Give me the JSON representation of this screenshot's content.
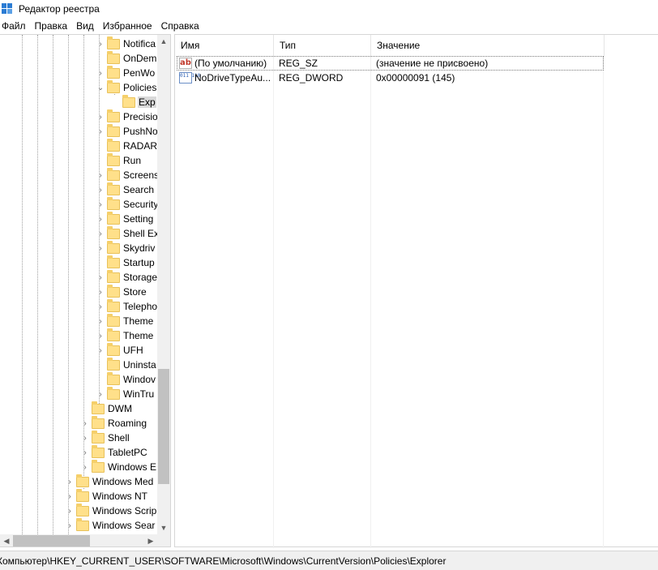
{
  "window": {
    "title": "Редактор реестра"
  },
  "menu": [
    "Файл",
    "Правка",
    "Вид",
    "Избранное",
    "Справка"
  ],
  "tree": {
    "items": [
      {
        "label": "Notifica",
        "expander": "›",
        "level": 3
      },
      {
        "label": "OnDem",
        "expander": "",
        "level": 3
      },
      {
        "label": "PenWo",
        "expander": "›",
        "level": 3
      },
      {
        "label": "Policies",
        "expander": "⌄",
        "level": 3
      },
      {
        "label": "Exp",
        "expander": "",
        "level": 4,
        "selected": true
      },
      {
        "label": "Precisio",
        "expander": "›",
        "level": 3
      },
      {
        "label": "PushNo",
        "expander": "›",
        "level": 3
      },
      {
        "label": "RADAR",
        "expander": "",
        "level": 3
      },
      {
        "label": "Run",
        "expander": "",
        "level": 3
      },
      {
        "label": "Screens",
        "expander": "›",
        "level": 3
      },
      {
        "label": "Search",
        "expander": "›",
        "level": 3
      },
      {
        "label": "Security",
        "expander": "›",
        "level": 3
      },
      {
        "label": "Setting",
        "expander": "›",
        "level": 3
      },
      {
        "label": "Shell Ex",
        "expander": "›",
        "level": 3
      },
      {
        "label": "Skydriv",
        "expander": "›",
        "level": 3
      },
      {
        "label": "Startup",
        "expander": "",
        "level": 3
      },
      {
        "label": "Storage",
        "expander": "›",
        "level": 3
      },
      {
        "label": "Store",
        "expander": "›",
        "level": 3
      },
      {
        "label": "Telepho",
        "expander": "›",
        "level": 3
      },
      {
        "label": "Theme",
        "expander": "›",
        "level": 3
      },
      {
        "label": "Theme",
        "expander": "›",
        "level": 3
      },
      {
        "label": "UFH",
        "expander": "›",
        "level": 3
      },
      {
        "label": "Uninsta",
        "expander": "",
        "level": 3
      },
      {
        "label": "Windov",
        "expander": "",
        "level": 3
      },
      {
        "label": "WinTru",
        "expander": "›",
        "level": 3
      },
      {
        "label": "DWM",
        "expander": "",
        "level": 2
      },
      {
        "label": "Roaming",
        "expander": "›",
        "level": 2
      },
      {
        "label": "Shell",
        "expander": "›",
        "level": 2
      },
      {
        "label": "TabletPC",
        "expander": "›",
        "level": 2
      },
      {
        "label": "Windows E",
        "expander": "›",
        "level": 2
      },
      {
        "label": "Windows Med",
        "expander": "›",
        "level": 1
      },
      {
        "label": "Windows NT",
        "expander": "›",
        "level": 1
      },
      {
        "label": "Windows Scrip",
        "expander": "›",
        "level": 1
      },
      {
        "label": "Windows Sear",
        "expander": "›",
        "level": 1
      }
    ]
  },
  "columns": {
    "name": "Имя",
    "type": "Тип",
    "value": "Значение"
  },
  "values": [
    {
      "icon": "string-value-icon",
      "icon_text": "ab",
      "name": "(По умолчанию)",
      "type": "REG_SZ",
      "data": "(значение не присвоено)"
    },
    {
      "icon": "binary-value-icon",
      "icon_text": "011 110",
      "name": "NoDriveTypeAu...",
      "type": "REG_DWORD",
      "data": "0x00000091 (145)"
    }
  ],
  "status": {
    "path": "Компьютер\\HKEY_CURRENT_USER\\SOFTWARE\\Microsoft\\Windows\\CurrentVersion\\Policies\\Explorer"
  },
  "colors": {
    "folder": "#ffe08a",
    "selection": "#d9d9d9",
    "accent": "#2b7cd3"
  }
}
